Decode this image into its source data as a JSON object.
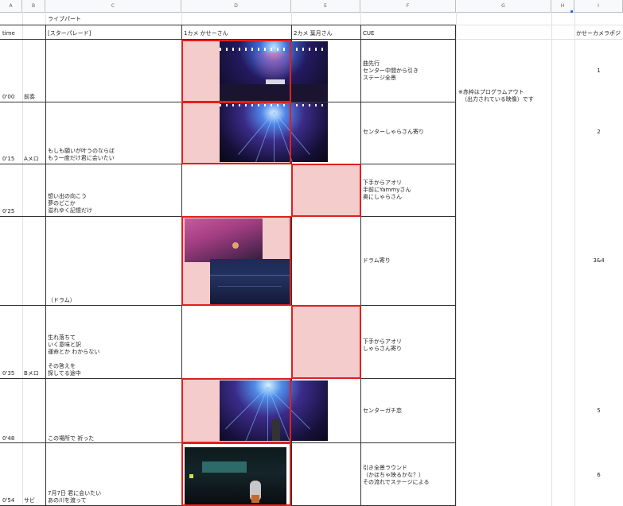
{
  "columns": [
    "A",
    "B",
    "C",
    "D",
    "E",
    "F",
    "G",
    "H",
    "I"
  ],
  "title": "ライブパート",
  "headers": {
    "time": "time",
    "lyrics": "[スターパレード]",
    "cam1": "1カメ かせーさん",
    "cam2": "2カメ 葉月さん",
    "cue": "CUE",
    "cam_col": "かせーカメラポジ"
  },
  "note": [
    "※赤枠はプログラムアウト",
    "（出力されている映像）です"
  ],
  "rows": [
    {
      "time": "0'00",
      "section": "前奏",
      "lyrics": "",
      "cue": "曲先行\nセンター中間から引き\nステージ全景",
      "pos": "1"
    },
    {
      "time": "0'15",
      "section": "Aメロ",
      "lyrics": "もしも願いが叶うのならば\nもう一度だけ君に会いたい",
      "cue": "センターしゃらさん寄り",
      "pos": "2"
    },
    {
      "time": "0'25",
      "section": "",
      "lyrics": "想い出の向こう\n夢のどこか\n溢れゆく記憶だけ",
      "cue": "下手からアオリ\n手前にYammyさん\n奥にしゃらさん",
      "pos": ""
    },
    {
      "time": "",
      "section": "",
      "lyrics": "（ドラム）",
      "cue": "ドラム寄り",
      "pos": "3&4"
    },
    {
      "time": "0'35",
      "section": "Bメロ",
      "lyrics": "生れ落ちて\nいく意味と訳\n運命とか わからない\n\nその答えを\n探してる途中",
      "cue": "下手からアオリ\nしゃらさん寄り",
      "pos": ""
    },
    {
      "time": "0'48",
      "section": "",
      "lyrics": "この場所で 祈った",
      "cue": "センターガチ恋",
      "pos": "5"
    },
    {
      "time": "0'54",
      "section": "サビ",
      "lyrics": "7月7日 君に会いたい\nあの川を渡って",
      "cue": "引き全景ラウンド\n（かほちゃ映るかな？）\nその流れでステージによる",
      "pos": "6"
    }
  ]
}
